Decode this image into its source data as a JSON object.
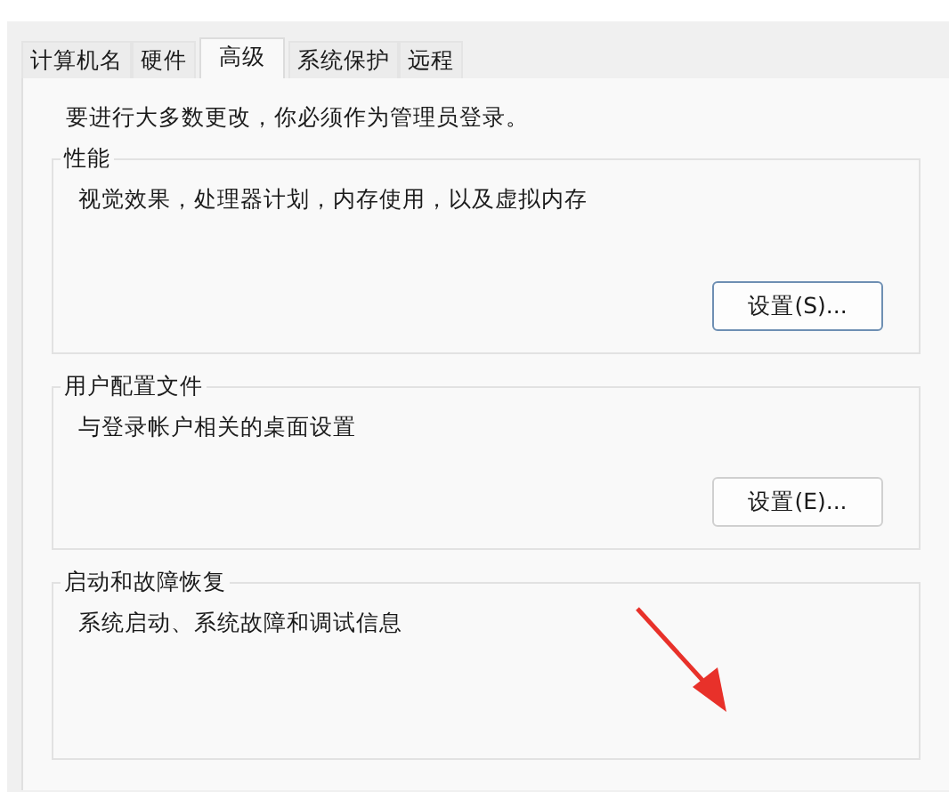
{
  "tabs": [
    {
      "label": "计算机名",
      "selected": false
    },
    {
      "label": "硬件",
      "selected": false
    },
    {
      "label": "高级",
      "selected": true
    },
    {
      "label": "系统保护",
      "selected": false
    },
    {
      "label": "远程",
      "selected": false
    }
  ],
  "notice": "要进行大多数更改，你必须作为管理员登录。",
  "groups": [
    {
      "title": "性能",
      "description": "视觉效果，处理器计划，内存使用，以及虚拟内存",
      "button": {
        "label": "设置(S)...",
        "focused": true
      }
    },
    {
      "title": "用户配置文件",
      "description": "与登录帐户相关的桌面设置",
      "button": {
        "label": "设置(E)...",
        "focused": false
      }
    },
    {
      "title": "启动和故障恢复",
      "description": "系统启动、系统故障和调试信息"
    }
  ],
  "annotation": {
    "kind": "arrow"
  }
}
